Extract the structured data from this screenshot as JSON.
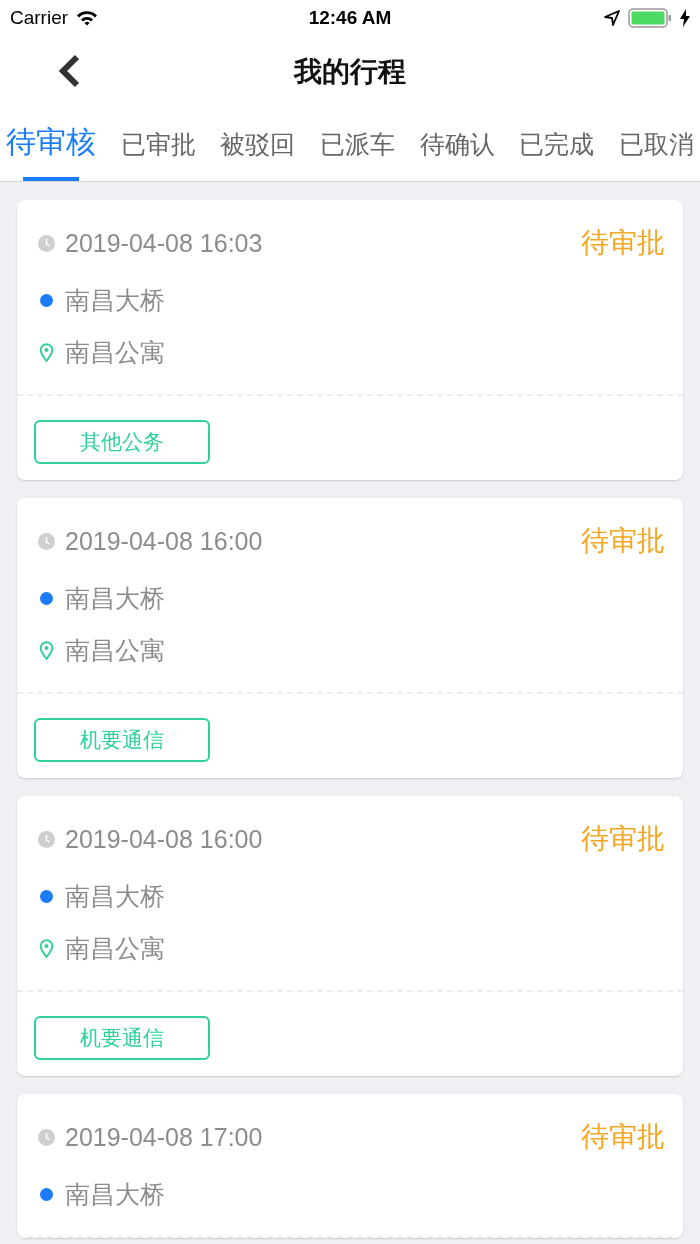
{
  "status_bar": {
    "carrier": "Carrier",
    "time": "12:46 AM"
  },
  "nav": {
    "title": "我的行程"
  },
  "tabs": [
    {
      "label": "待审核",
      "selected": true
    },
    {
      "label": "已审批",
      "selected": false
    },
    {
      "label": "被驳回",
      "selected": false
    },
    {
      "label": "已派车",
      "selected": false
    },
    {
      "label": "待确认",
      "selected": false
    },
    {
      "label": "已完成",
      "selected": false
    },
    {
      "label": "已取消",
      "selected": false
    }
  ],
  "trips": [
    {
      "time": "2019-04-08 16:03",
      "status": "待审批",
      "from": "南昌大桥",
      "to": "南昌公寓",
      "tag": "其他公务"
    },
    {
      "time": "2019-04-08 16:00",
      "status": "待审批",
      "from": "南昌大桥",
      "to": "南昌公寓",
      "tag": "机要通信"
    },
    {
      "time": "2019-04-08 16:00",
      "status": "待审批",
      "from": "南昌大桥",
      "to": "南昌公寓",
      "tag": "机要通信"
    },
    {
      "time": "2019-04-08 17:00",
      "status": "待审批",
      "from": "南昌大桥"
    }
  ]
}
